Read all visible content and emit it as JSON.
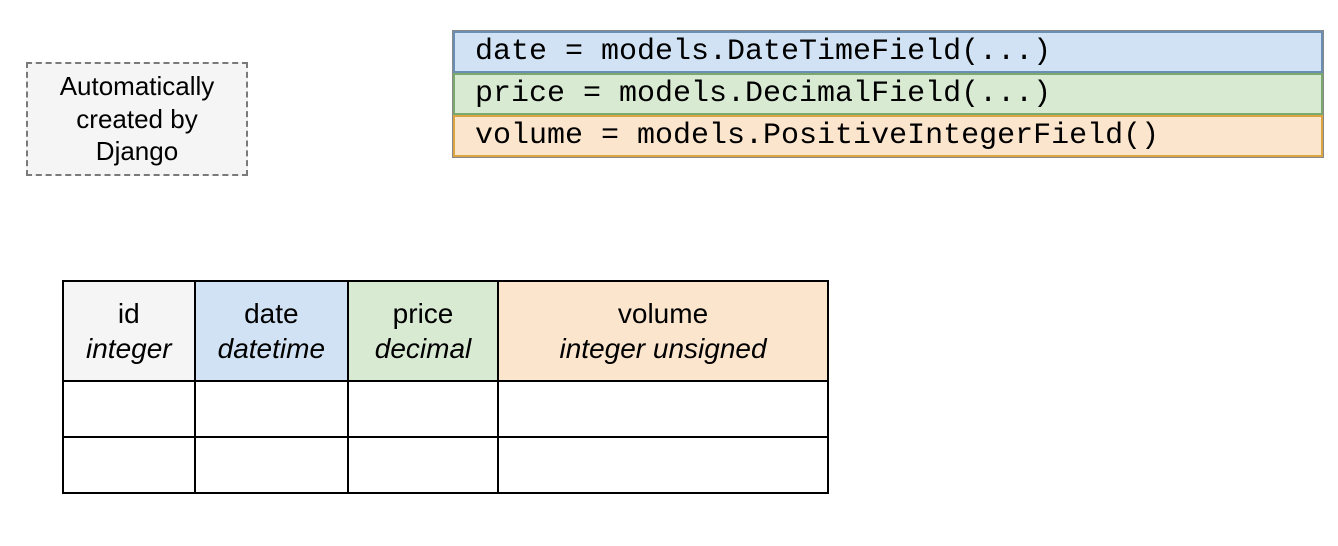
{
  "note": "Automatically\ncreated by\nDjango",
  "code": {
    "date": "date = models.DateTimeField(...)",
    "price": "price = models.DecimalField(...)",
    "volume": "volume = models.PositiveIntegerField()"
  },
  "table": {
    "columns": [
      {
        "name": "id",
        "type": "integer"
      },
      {
        "name": "date",
        "type": "datetime"
      },
      {
        "name": "price",
        "type": "decimal"
      },
      {
        "name": "volume",
        "type": "integer unsigned"
      }
    ]
  },
  "colors": {
    "id_bg": "#f5f5f5",
    "date_bg": "#d0e2f3",
    "price_bg": "#d9ead3",
    "volume_bg": "#fce5cd"
  }
}
